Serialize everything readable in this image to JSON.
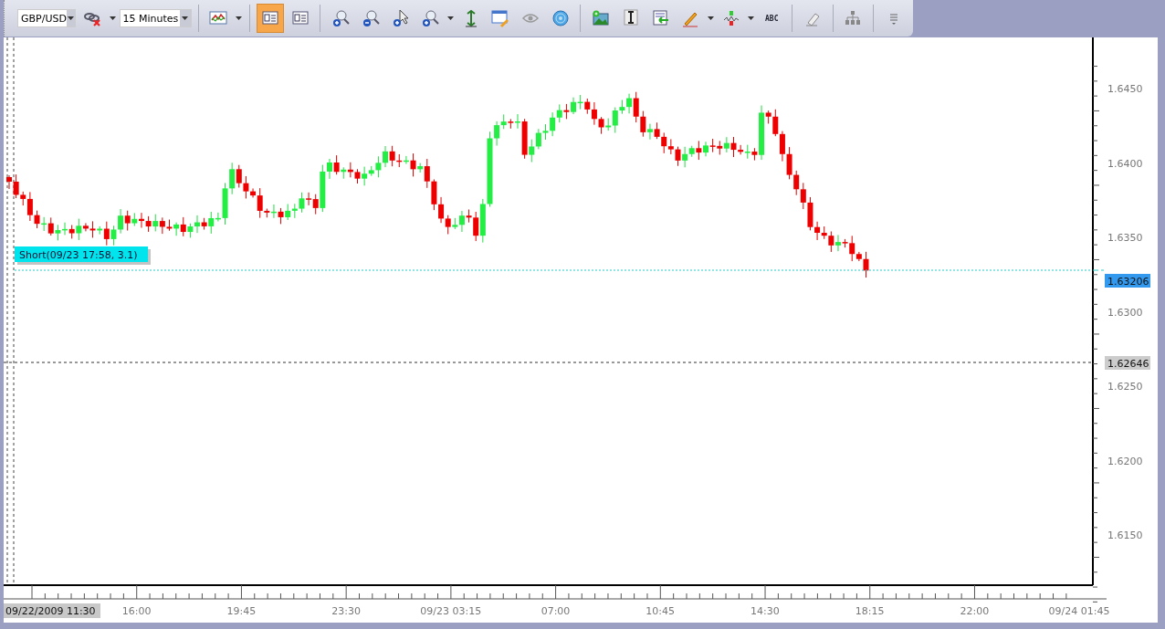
{
  "toolbar": {
    "groups": [
      {
        "items": [
          {
            "kind": "combo",
            "value": "GBP/USD"
          },
          {
            "kind": "link-remove",
            "dropdown": true,
            "selected": false
          },
          {
            "kind": "combo",
            "value": "15 Minutes"
          }
        ]
      },
      {
        "items": [
          {
            "kind": "chart-type",
            "dropdown": true,
            "selected": false
          }
        ]
      },
      {
        "items": [
          {
            "kind": "panel-b",
            "dropdown": false,
            "selected": true
          },
          {
            "kind": "panel-a",
            "dropdown": false,
            "selected": false
          }
        ]
      },
      {
        "items": [
          {
            "kind": "zoom-in",
            "dropdown": false,
            "selected": false
          },
          {
            "kind": "zoom-out",
            "dropdown": false,
            "selected": false
          },
          {
            "kind": "pointer-plus",
            "dropdown": false,
            "selected": false
          },
          {
            "kind": "zoom-range",
            "dropdown": true,
            "selected": false
          },
          {
            "kind": "fit-vertical",
            "dropdown": false,
            "selected": false
          },
          {
            "kind": "window-edit",
            "dropdown": false,
            "selected": false
          },
          {
            "kind": "eye",
            "dropdown": false,
            "selected": false
          },
          {
            "kind": "globe",
            "dropdown": false,
            "selected": false
          }
        ]
      },
      {
        "items": [
          {
            "kind": "image-add",
            "dropdown": false,
            "selected": false
          },
          {
            "kind": "text-cursor",
            "dropdown": false,
            "selected": false
          },
          {
            "kind": "list-arrow",
            "dropdown": false,
            "selected": false
          },
          {
            "kind": "pencil",
            "dropdown": true,
            "selected": false
          },
          {
            "kind": "indicator",
            "dropdown": true,
            "selected": false
          },
          {
            "kind": "abc",
            "label": "ABC",
            "dropdown": false,
            "selected": false
          }
        ]
      },
      {
        "items": [
          {
            "kind": "eraser",
            "dropdown": false,
            "selected": false
          }
        ]
      },
      {
        "items": [
          {
            "kind": "hierarchy",
            "dropdown": false,
            "selected": false
          }
        ]
      },
      {
        "items": [
          {
            "kind": "overflow",
            "dropdown": false,
            "selected": false
          }
        ]
      }
    ]
  },
  "chart": {
    "price_labels": [
      "1.6450",
      "1.6400",
      "1.6350",
      "1.6300",
      "1.6250",
      "1.6200",
      "1.6150"
    ],
    "time_labels": [
      "16:00",
      "19:45",
      "23:30",
      "09/23 03:15",
      "07:00",
      "10:45",
      "14:30",
      "18:15",
      "22:00",
      "09/24 01:45"
    ],
    "cursor_time": "09/22/2009 11:30",
    "order_label": "Short(09/23 17:58, 3.1)",
    "current_price": "1.63206",
    "cursor_price": "1.62646"
  }
}
